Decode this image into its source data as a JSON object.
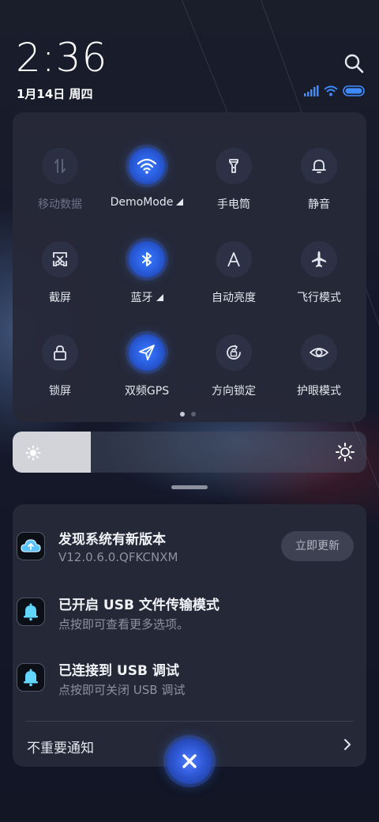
{
  "status_bar": {
    "time": "2:36",
    "date": "1月14日 周四"
  },
  "quick_settings": {
    "tiles": [
      {
        "label": "移动数据",
        "icon": "mobile-data-icon",
        "state": "disabled"
      },
      {
        "label": "DemoMode",
        "icon": "wifi-icon",
        "state": "on",
        "expandable": true
      },
      {
        "label": "手电筒",
        "icon": "flashlight-icon",
        "state": "off"
      },
      {
        "label": "静音",
        "icon": "bell-icon",
        "state": "off"
      },
      {
        "label": "截屏",
        "icon": "screenshot-icon",
        "state": "off"
      },
      {
        "label": "蓝牙",
        "icon": "bluetooth-icon",
        "state": "on",
        "expandable": true
      },
      {
        "label": "自动亮度",
        "icon": "auto-brightness-icon",
        "state": "off"
      },
      {
        "label": "飞行模式",
        "icon": "airplane-icon",
        "state": "off"
      },
      {
        "label": "锁屏",
        "icon": "lock-icon",
        "state": "off"
      },
      {
        "label": "双频GPS",
        "icon": "gps-icon",
        "state": "on"
      },
      {
        "label": "方向锁定",
        "icon": "rotation-lock-icon",
        "state": "off"
      },
      {
        "label": "护眼模式",
        "icon": "eye-icon",
        "state": "off"
      }
    ],
    "page_count": 2,
    "current_page": 1
  },
  "brightness": {
    "level": 0.22
  },
  "notifications": [
    {
      "app_icon": "cloud-update-icon",
      "title": "发现系统有新版本",
      "subtitle": "V12.0.6.0.QFKCNXM",
      "action_label": "立即更新"
    },
    {
      "app_icon": "bell-app-icon",
      "title": "已开启 USB 文件传输模式",
      "subtitle": "点按即可查看更多选项。"
    },
    {
      "app_icon": "bell-app-icon",
      "title": "已连接到 USB 调试",
      "subtitle": "点按即可关闭 USB 调试"
    }
  ],
  "unimportant": {
    "label": "不重要通知"
  },
  "colors": {
    "accent": "#2f6bff",
    "panel": "#262938",
    "tile_off": "#2c3146"
  }
}
